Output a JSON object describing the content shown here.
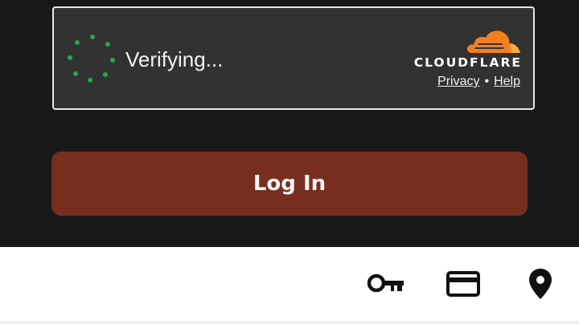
{
  "turnstile": {
    "status_text": "Verifying...",
    "brand_name": "CLOUDFLARE",
    "privacy_link": "Privacy",
    "separator": "•",
    "help_link": "Help",
    "spinner_color": "#27a845",
    "cloud_color": "#f38020"
  },
  "login": {
    "button_label": "Log In",
    "button_color": "#772e1f"
  },
  "bottom_bar": {
    "icons": [
      "key-icon",
      "credit-card-icon",
      "location-pin-icon"
    ]
  }
}
